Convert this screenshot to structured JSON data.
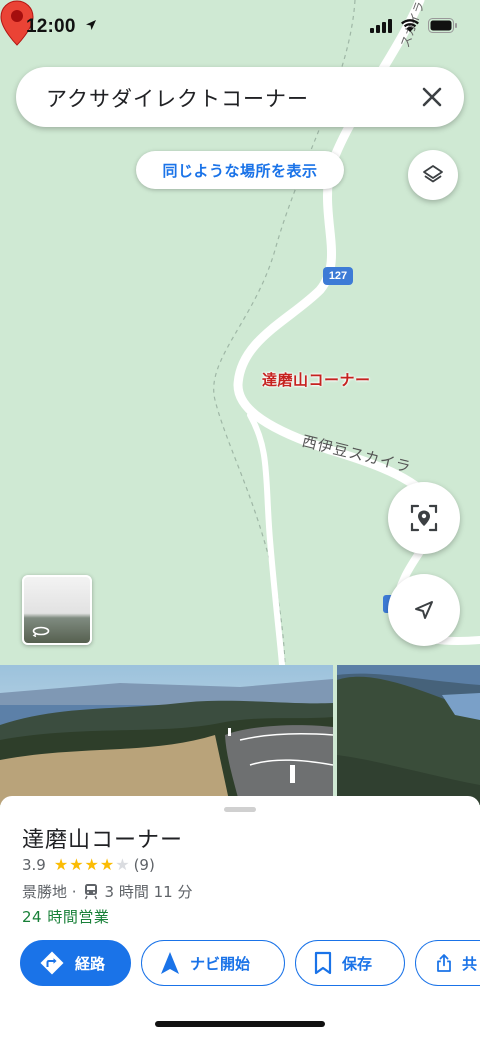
{
  "status_bar": {
    "time": "12:00"
  },
  "search": {
    "query": "アクサダイレクトコーナー"
  },
  "map": {
    "similar_places_label": "同じような場所を表示",
    "route_number": "127",
    "road_name": "西伊豆スカイラ",
    "road_name_top": "スカイラ",
    "place_label": "達磨山コーナー",
    "pin_color": "#ea4335",
    "land_color": "#cfe9d3"
  },
  "place": {
    "title": "達磨山コーナー",
    "rating": "3.9",
    "stars_filled": 4,
    "review_count": "(9)",
    "category": "景勝地 ·",
    "transit_time": "3 時間 11 分",
    "hours": "24 時間営業"
  },
  "actions": {
    "directions": "経路",
    "start": "ナビ開始",
    "save": "保存",
    "share": "共"
  },
  "colors": {
    "accent": "#1a73e8",
    "open_green": "#188038",
    "star": "#fbbc04"
  }
}
